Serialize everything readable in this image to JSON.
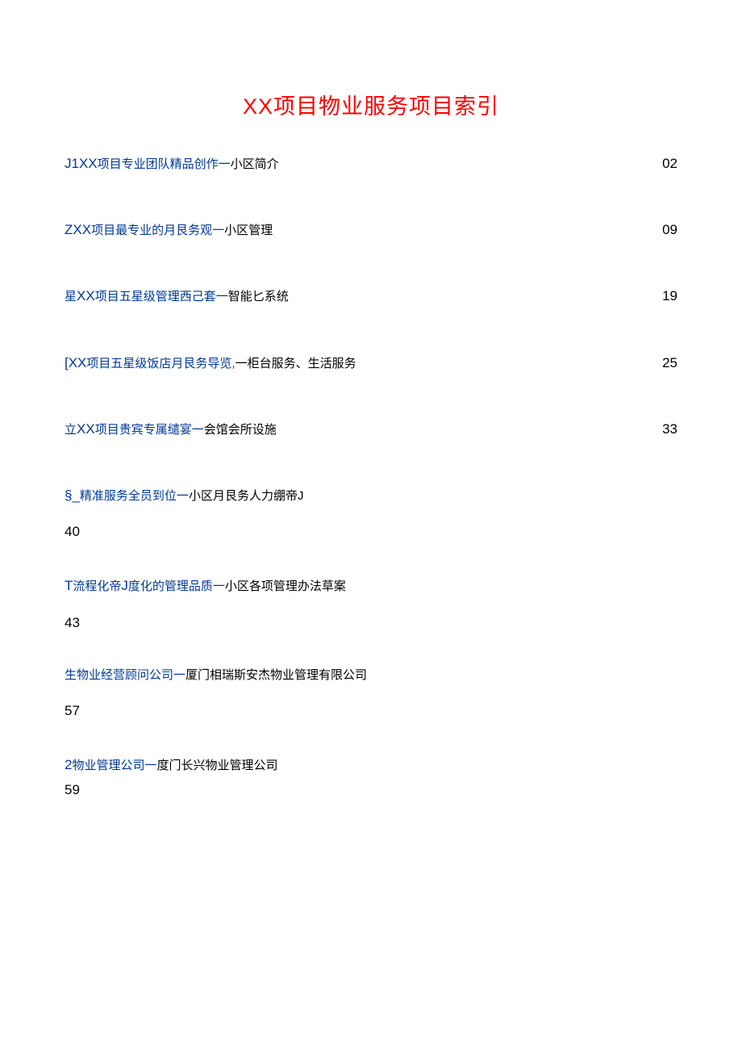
{
  "title_prefix": "XX",
  "title_suffix": "项目物业服务项目索引",
  "entries": [
    {
      "link_ascii": "J1XX",
      "link_cn": "项目专业团队精品创作一",
      "text": "小区简介",
      "page": "02",
      "layout": "inline"
    },
    {
      "link_ascii": "ZXX",
      "link_cn": "项目最专业的月艮务观一",
      "text": "小区管理",
      "page": "09",
      "layout": "inline"
    },
    {
      "link_prefix_cn": "星",
      "link_ascii": "XX",
      "link_cn": "项目五星级管理西己套一",
      "text": "智能匕系统",
      "page": "19",
      "layout": "inline"
    },
    {
      "link_ascii": "[XX",
      "link_cn": "项目五星级饭店月艮务导览,",
      "text": "一柜台服务、生活服务",
      "page": "25",
      "layout": "inline"
    },
    {
      "link_prefix_cn": "立",
      "link_ascii": "XX",
      "link_cn": "项目贵宾专属缱宴一",
      "text": "会馆会所设施",
      "page": "33",
      "layout": "inline"
    },
    {
      "link_ascii": "§_",
      "link_cn": "精准服务全员到位一",
      "text_cn": "小区月艮务人力绷帝",
      "text_ascii": "J",
      "page": "40",
      "layout": "block"
    },
    {
      "link_ascii_pre": "T",
      "link_cn_mid1": "流程化帝",
      "link_ascii_mid": "J",
      "link_cn_mid2": "度化的管理品质一",
      "text": "小区各项管理办法草案",
      "page": "43",
      "layout": "block"
    },
    {
      "link_cn": "生物业经营顾问公司一",
      "text": "厦门相瑞斯安杰物业管理有限公司",
      "page": "57",
      "layout": "block"
    },
    {
      "link_ascii": "2",
      "link_cn": "物业管理公司一",
      "text": "度门长兴物业管理公司",
      "page": "59",
      "layout": "block_tight"
    }
  ]
}
